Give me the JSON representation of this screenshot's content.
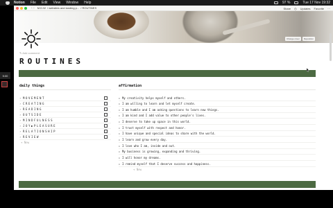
{
  "menubar": {
    "app": "Notion",
    "items": [
      "File",
      "Edit",
      "View",
      "Window",
      "Help"
    ],
    "status": {
      "battery": "97 %",
      "datetime": "Tue 17 Nov 19:32"
    }
  },
  "titlebar": {
    "crumb_workspace": "M.D.W",
    "crumb_page": "websites and landing p...",
    "crumb_current": "ROUTINES",
    "share": "Share",
    "updates": "Updates",
    "favorite": "Favorite"
  },
  "cover": {
    "change_cover": "Change cover",
    "reposition": "Reposition"
  },
  "page": {
    "add_comment": "Add comment",
    "title": "ROUTINES"
  },
  "daily_things": {
    "heading": "daily things",
    "items": [
      "MOVEMENT",
      "CREATING",
      "READING",
      "OUTSIDE",
      "MINDFULNESS",
      "JOY▶PLEASURE",
      "RELATIONSHIP",
      "REVIEW"
    ],
    "add_new": "New"
  },
  "affirmation": {
    "heading": "affirmation",
    "items": [
      "My creativity helps myself and others.",
      "I am willing to learn and let myself create.",
      "I am humble and I am asking questions to learn new things.",
      "I am kind and I add value to other people's lives.",
      "I deserve to take up space in this world.",
      "I trust myself with respect and honor.",
      "I have unique and special ideas to share with the world.",
      "I learn and grow every day.",
      "I love who I am, inside and out.",
      "My business is growing, expanding and thriving.",
      "I will honor my dreams.",
      "I remind myself that I deserve success and happiness."
    ],
    "add_new": "New"
  },
  "sidebar_mini": {
    "time": "5:00"
  },
  "colors": {
    "accent_green": "#4c6a42",
    "menubar": "#1b1b1b"
  }
}
